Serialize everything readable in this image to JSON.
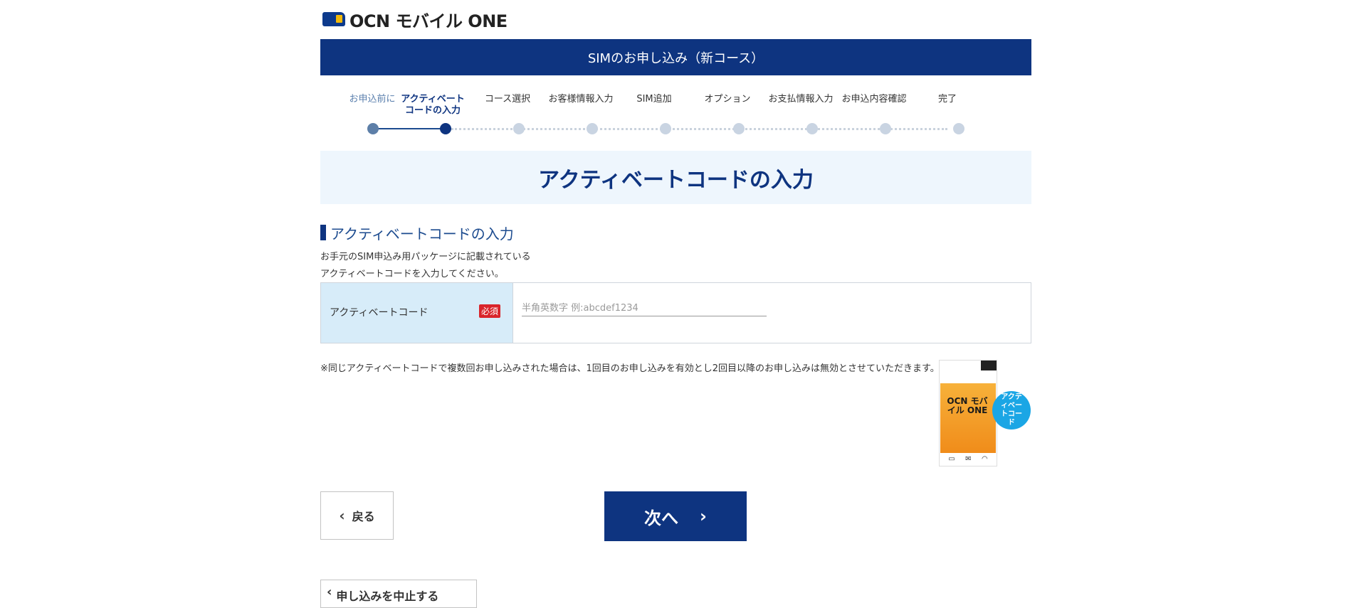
{
  "logo": {
    "text": "OCN モバイル ONE"
  },
  "header": {
    "title": "SIMのお申し込み（新コース）"
  },
  "steps": [
    {
      "label": "お申込前に",
      "state": "done"
    },
    {
      "label": "アクティベートコードの入力",
      "state": "current"
    },
    {
      "label": "コース選択",
      "state": "todo"
    },
    {
      "label": "お客様情報入力",
      "state": "todo"
    },
    {
      "label": "SIM追加",
      "state": "todo"
    },
    {
      "label": "オプション",
      "state": "todo"
    },
    {
      "label": "お支払情報入力",
      "state": "todo"
    },
    {
      "label": "お申込内容確認",
      "state": "todo"
    },
    {
      "label": "完了",
      "state": "todo"
    }
  ],
  "page_title": "アクティベートコードの入力",
  "section": {
    "title": "アクティベートコードの入力",
    "desc_line1": "お手元のSIM申込み用パッケージに記載されている",
    "desc_line2": "アクティベートコードを入力してください。"
  },
  "form": {
    "label": "アクティベートコード",
    "required_badge": "必須",
    "placeholder": "半角英数字 例:abcdef1234",
    "value": ""
  },
  "note": "※同じアクティベートコードで複数回お申し込みされた場合は、1回目のお申し込みを有効とし2回目以降のお申し込みは無効とさせていただきます。",
  "package": {
    "product_text": "OCN モバイル ONE",
    "sub_text": "エントリーパッケージ",
    "badge": "アクティベートコード"
  },
  "buttons": {
    "back": "戻る",
    "next": "次へ",
    "cancel": "申し込みを中止する"
  },
  "colors": {
    "brand_navy": "#0e3480",
    "title_bg": "#eef6fd",
    "label_bg": "#d7ecf9",
    "required_red": "#d9252b",
    "badge_blue": "#1ba6e5"
  }
}
